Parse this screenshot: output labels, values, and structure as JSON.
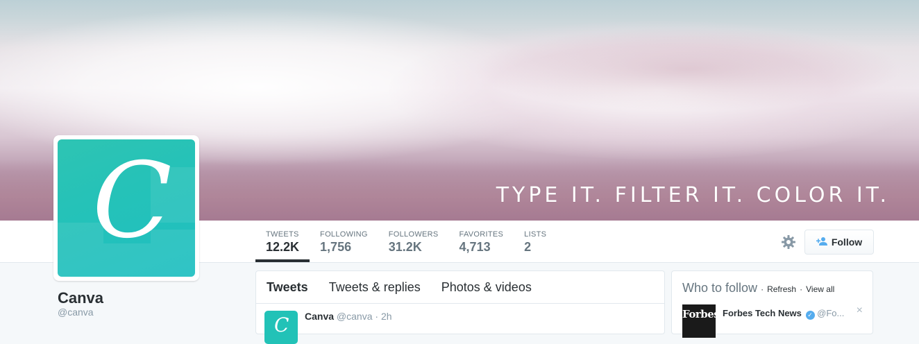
{
  "banner": {
    "tagline": "TYPE IT. FILTER IT. COLOR IT."
  },
  "profile": {
    "avatar_letter": "C",
    "name": "Canva",
    "handle": "@canva"
  },
  "stats": [
    {
      "label": "TWEETS",
      "value": "12.2K"
    },
    {
      "label": "FOLLOWING",
      "value": "1,756"
    },
    {
      "label": "FOLLOWERS",
      "value": "31.2K"
    },
    {
      "label": "FAVORITES",
      "value": "4,713"
    },
    {
      "label": "LISTS",
      "value": "2"
    }
  ],
  "actions": {
    "settings_icon": "gear-icon",
    "follow_label": "Follow",
    "follow_icon": "add-user-icon"
  },
  "timeline": {
    "tabs": [
      "Tweets",
      "Tweets & replies",
      "Photos & videos"
    ],
    "tweet": {
      "name": "Canva",
      "handle": "@canva",
      "time": "2h",
      "separator": "·",
      "avatar_letter": "C"
    }
  },
  "who_to_follow": {
    "title": "Who to follow",
    "separator": "·",
    "refresh": "Refresh",
    "view_all": "View all",
    "item": {
      "logo_text": "Forbes",
      "name": "Forbes Tech News",
      "handle": "@Fo...",
      "dismiss": "×",
      "verified_mark": "✓"
    }
  },
  "colors": {
    "accent": "#55acee",
    "brand": "#22c2b7",
    "text": "#292f33",
    "muted": "#8899a6"
  }
}
